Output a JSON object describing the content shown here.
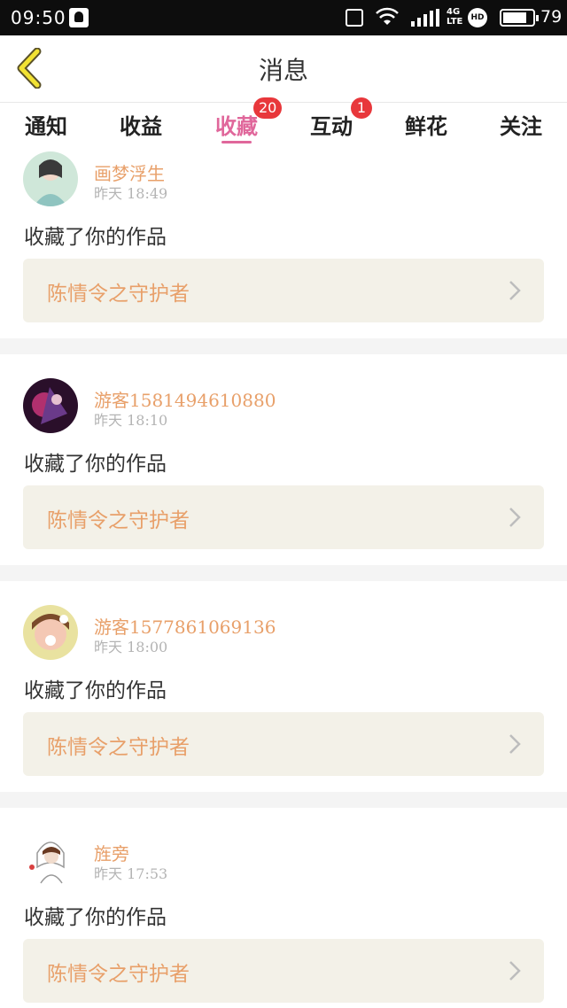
{
  "status_bar": {
    "time": "09:50",
    "network": "4G",
    "hd": "HD",
    "battery": "79"
  },
  "header": {
    "title": "消息"
  },
  "tabs": [
    {
      "label": "通知",
      "badge": ""
    },
    {
      "label": "收益",
      "badge": ""
    },
    {
      "label": "收藏",
      "badge": "20",
      "active": true
    },
    {
      "label": "互动",
      "badge": "1"
    },
    {
      "label": "鲜花",
      "badge": ""
    },
    {
      "label": "关注",
      "badge": ""
    }
  ],
  "items": [
    {
      "username": "画梦浮生",
      "time": "昨天  18:49",
      "action": "收藏了你的作品",
      "work": "陈情令之守护者"
    },
    {
      "username": "游客1581494610880",
      "time": "昨天  18:10",
      "action": "收藏了你的作品",
      "work": "陈情令之守护者"
    },
    {
      "username": "游客1577861069136",
      "time": "昨天  18:00",
      "action": "收藏了你的作品",
      "work": "陈情令之守护者"
    },
    {
      "username": "旌旁",
      "time": "昨天  17:53",
      "action": "收藏了你的作品",
      "work": "陈情令之守护者"
    }
  ],
  "colors": {
    "accent": "#e0679b",
    "username": "#e8a06a",
    "badge": "#e8373b",
    "work_bg": "#f3f1e8"
  }
}
